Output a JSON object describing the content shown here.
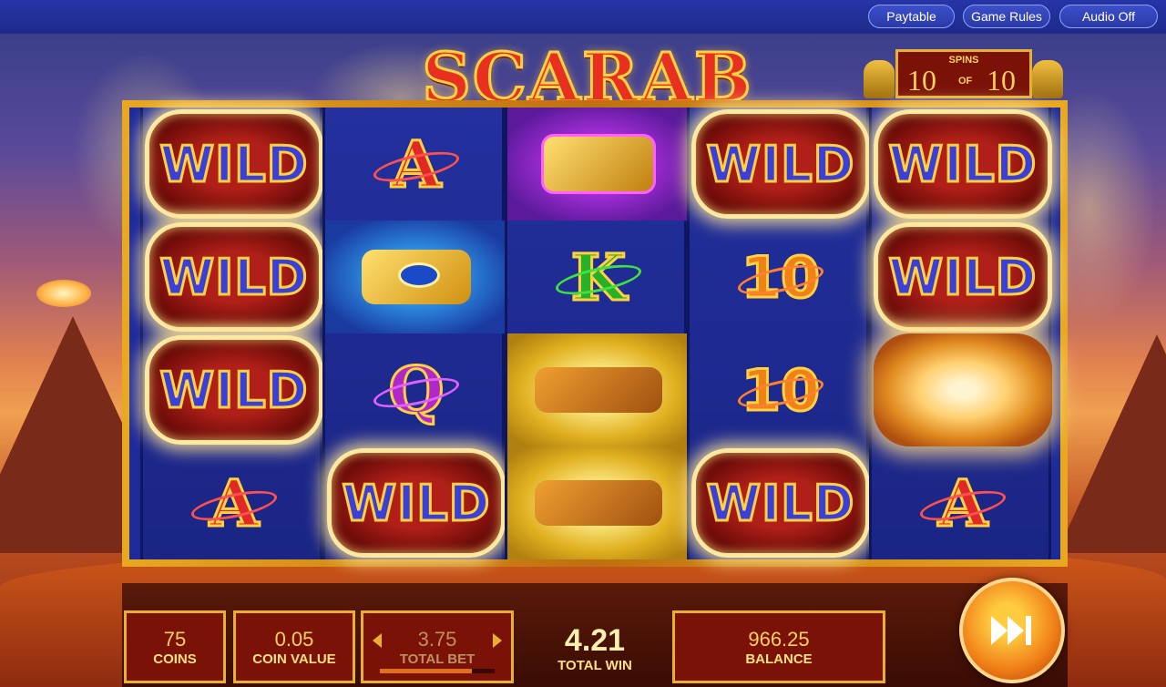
{
  "toolbar": {
    "paytable_label": "Paytable",
    "game_rules_label": "Game Rules",
    "audio_label": "Audio Off"
  },
  "game": {
    "title": "SCARAB",
    "spins": {
      "label": "SPINS",
      "current": "10",
      "of": "OF",
      "total": "10"
    }
  },
  "reels": [
    [
      "WILD",
      "WILD",
      "WILD",
      "A"
    ],
    [
      "A",
      "eye-of-horus-icon",
      "Q",
      "WILD"
    ],
    [
      "golden-scarab-icon",
      "K",
      "sphinx-icon",
      "sphinx-icon"
    ],
    [
      "WILD",
      "10",
      "10",
      "WILD"
    ],
    [
      "WILD",
      "WILD",
      "explosion",
      "A"
    ]
  ],
  "panel": {
    "coins": {
      "value": "75",
      "label": "COINS"
    },
    "coin_value": {
      "value": "0.05",
      "label": "COIN VALUE"
    },
    "total_bet": {
      "value": "3.75",
      "label": "TOTAL BET"
    },
    "total_win": {
      "value": "4.21",
      "label": "TOTAL WIN"
    },
    "balance": {
      "value": "966.25",
      "label": "BALANCE"
    }
  },
  "colors": {
    "accent": "#e8b030",
    "panel": "#7a1208",
    "reel": "#1e2a9a"
  }
}
